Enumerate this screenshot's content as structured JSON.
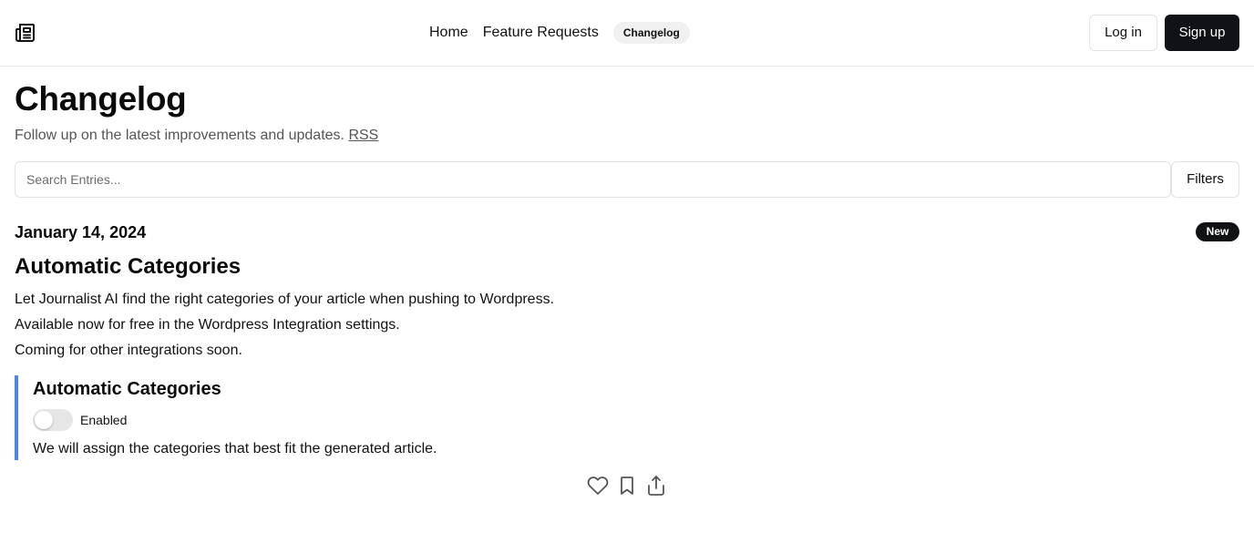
{
  "header": {
    "logo_icon": "newspaper-icon",
    "nav": [
      {
        "label": "Home"
      },
      {
        "label": "Feature Requests"
      },
      {
        "label": "Changelog",
        "active": true
      }
    ],
    "login_label": "Log in",
    "signup_label": "Sign up"
  },
  "page": {
    "title": "Changelog",
    "subtitle": "Follow up on the latest improvements and updates.",
    "rss_label": "RSS"
  },
  "search": {
    "placeholder": "Search Entries...",
    "value": "",
    "filters_label": "Filters"
  },
  "entry": {
    "date": "January 14, 2024",
    "badge": "New",
    "title": "Automatic Categories",
    "body": [
      "Let Journalist AI find the right categories of your article when pushing to Wordpress.",
      "Available now for free in the Wordpress Integration settings.",
      "Coming for other integrations soon."
    ],
    "callout": {
      "title": "Automatic Categories",
      "toggle_label": "Enabled",
      "toggle_on": false,
      "description": "We will assign the categories that best fit the generated article.",
      "accent_color": "#4a86e0"
    },
    "actions": [
      {
        "icon": "heart-icon"
      },
      {
        "icon": "bookmark-icon"
      },
      {
        "icon": "share-icon"
      }
    ]
  },
  "colors": {
    "primary_button": "#111216",
    "border": "#e2e2e2",
    "pill_bg": "#f0f0f0"
  }
}
